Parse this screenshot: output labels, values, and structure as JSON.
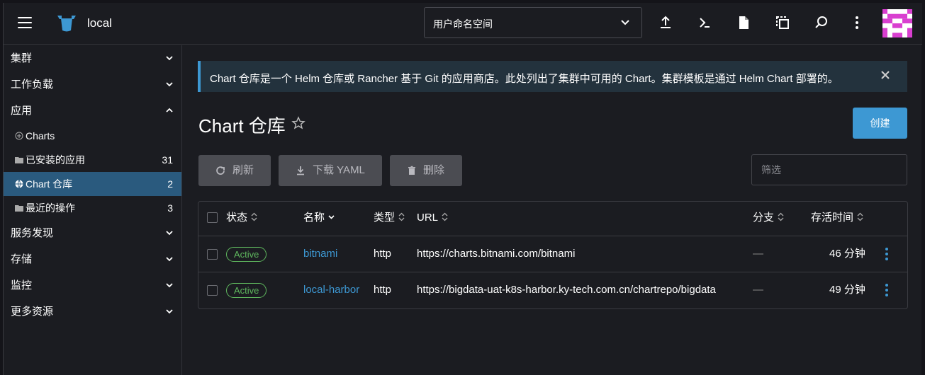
{
  "header": {
    "cluster_name": "local",
    "namespace_select": "用户命名空间",
    "icons": [
      "upload-icon",
      "terminal-icon",
      "file-icon",
      "copy-icon",
      "search-icon",
      "more-icon"
    ]
  },
  "sidebar": {
    "groups": {
      "cluster": "集群",
      "workload": "工作负载",
      "apps": "应用",
      "service": "服务发现",
      "storage": "存储",
      "monitor": "监控",
      "more": "更多资源"
    },
    "apps_items": [
      {
        "label": "Charts",
        "count": ""
      },
      {
        "label": "已安装的应用",
        "count": "31"
      },
      {
        "label": "Chart 仓库",
        "count": "2"
      },
      {
        "label": "最近的操作",
        "count": "3"
      }
    ]
  },
  "banner": {
    "text": "Chart 仓库是一个 Helm 仓库或 Rancher 基于 Git 的应用商店。此处列出了集群中可用的 Chart。集群模板是通过 Helm Chart 部署的。"
  },
  "page": {
    "title": "Chart 仓库",
    "create_label": "创建",
    "refresh_label": "刷新",
    "download_label": "下载 YAML",
    "delete_label": "删除",
    "filter_placeholder": "筛选"
  },
  "table": {
    "columns": {
      "state": "状态",
      "name": "名称",
      "type": "类型",
      "url": "URL",
      "branch": "分支",
      "age": "存活时间"
    },
    "rows": [
      {
        "state": "Active",
        "name": "bitnami",
        "type": "http",
        "url": "https://charts.bitnami.com/bitnami",
        "branch": "—",
        "age": "46 分钟"
      },
      {
        "state": "Active",
        "name": "local-harbor",
        "type": "http",
        "url": "https://bigdata-uat-k8s-harbor.ky-tech.com.cn/chartrepo/bigdata",
        "branch": "—",
        "age": "49 分钟"
      }
    ]
  },
  "colors": {
    "accent": "#3d98d3",
    "active_green": "#5fb85e",
    "sidebar_active": "#2a5a7e"
  }
}
